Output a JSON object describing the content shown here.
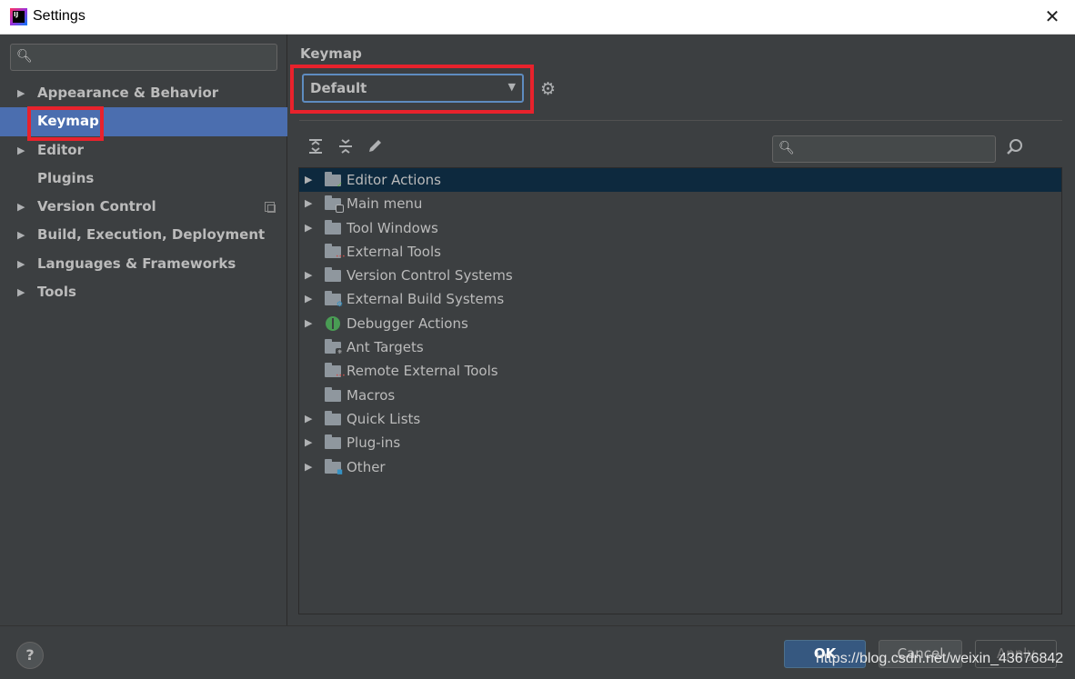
{
  "window": {
    "title": "Settings",
    "app_icon_text": "IJ",
    "close_glyph": "✕"
  },
  "sidebar": {
    "search_placeholder": "",
    "items": [
      {
        "label": "Appearance & Behavior",
        "expandable": true
      },
      {
        "label": "Keymap",
        "expandable": false,
        "selected": true
      },
      {
        "label": "Editor",
        "expandable": true
      },
      {
        "label": "Plugins",
        "expandable": false
      },
      {
        "label": "Version Control",
        "expandable": true,
        "badge": "copy-icon"
      },
      {
        "label": "Build, Execution, Deployment",
        "expandable": true
      },
      {
        "label": "Languages & Frameworks",
        "expandable": true
      },
      {
        "label": "Tools",
        "expandable": true
      }
    ]
  },
  "keymap": {
    "title": "Keymap",
    "scheme_value": "Default",
    "toolbar_icons": [
      "expand-all-icon",
      "collapse-all-icon",
      "edit-shortcut-icon"
    ],
    "search_placeholder": "",
    "tree": [
      {
        "label": "Editor Actions",
        "expandable": true,
        "selected": true,
        "icon": "editor-actions-folder-icon"
      },
      {
        "label": "Main menu",
        "expandable": true,
        "icon": "main-menu-folder-icon"
      },
      {
        "label": "Tool Windows",
        "expandable": true,
        "icon": "folder-icon"
      },
      {
        "label": "External Tools",
        "expandable": false,
        "icon": "external-tools-folder-icon"
      },
      {
        "label": "Version Control Systems",
        "expandable": true,
        "icon": "folder-icon"
      },
      {
        "label": "External Build Systems",
        "expandable": true,
        "icon": "build-systems-folder-icon"
      },
      {
        "label": "Debugger Actions",
        "expandable": true,
        "icon": "bug-icon"
      },
      {
        "label": "Ant Targets",
        "expandable": false,
        "icon": "ant-folder-icon"
      },
      {
        "label": "Remote External Tools",
        "expandable": false,
        "icon": "external-tools-folder-icon"
      },
      {
        "label": "Macros",
        "expandable": false,
        "icon": "folder-icon"
      },
      {
        "label": "Quick Lists",
        "expandable": true,
        "icon": "folder-icon"
      },
      {
        "label": "Plug-ins",
        "expandable": true,
        "icon": "folder-icon"
      },
      {
        "label": "Other",
        "expandable": true,
        "icon": "other-folder-icon"
      }
    ]
  },
  "footer": {
    "help_label": "?",
    "ok_label": "OK",
    "cancel_label": "Cancel",
    "apply_label": "Apply",
    "watermark": "https://blog.csdn.net/weixin_43676842"
  },
  "colors": {
    "background": "#3c3f41",
    "selection_sidebar": "#4b6eaf",
    "selection_tree": "#0d293e",
    "highlight_box": "#e8222c",
    "text": "#bbbbbb"
  }
}
